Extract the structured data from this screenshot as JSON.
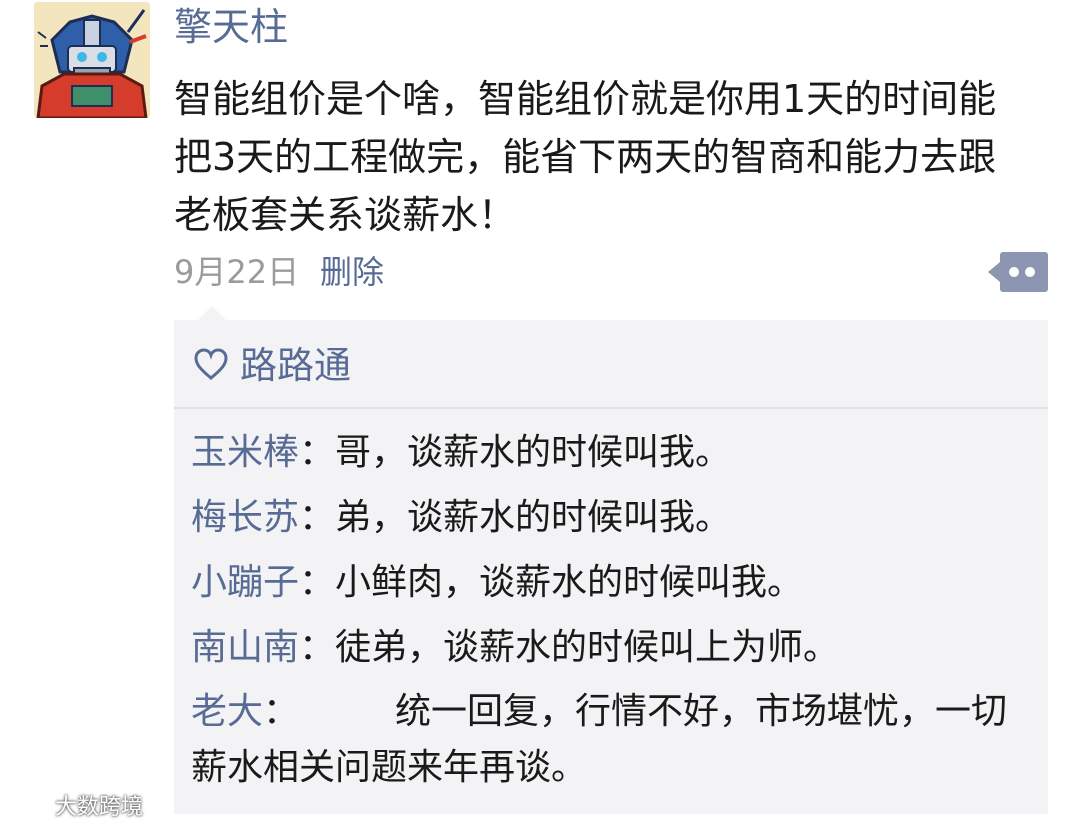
{
  "post": {
    "author": "擎天柱",
    "text": "智能组价是个啥，智能组价就是你用1天的时间能把3天的工程做完，能省下两天的智商和能力去跟老板套关系谈薪水！",
    "date": "9月22日",
    "delete_label": "删除",
    "more_icon": "more-dots-icon"
  },
  "likes": {
    "icon": "heart-icon",
    "names": "路路通"
  },
  "comments": [
    {
      "name": "玉米棒",
      "sep": "：",
      "text": "哥，谈薪水的时候叫我。"
    },
    {
      "name": "梅长苏",
      "sep": "：",
      "text": "弟，谈薪水的时候叫我。"
    },
    {
      "name": "小蹦子",
      "sep": "：",
      "text": "小鲜肉，谈薪水的时候叫我。"
    },
    {
      "name": "南山南",
      "sep": "：",
      "text": "徒弟，谈薪水的时候叫上为师。"
    },
    {
      "name": "老大",
      "sep": "：",
      "text": "统一回复，行情不好，市场堪忧，一切薪水相关问题来年再谈。"
    }
  ],
  "watermark": {
    "text": "大数跨境"
  },
  "colors": {
    "link": "#576b95",
    "comment_bg": "#f3f3f5",
    "date": "#9b9b9b"
  }
}
